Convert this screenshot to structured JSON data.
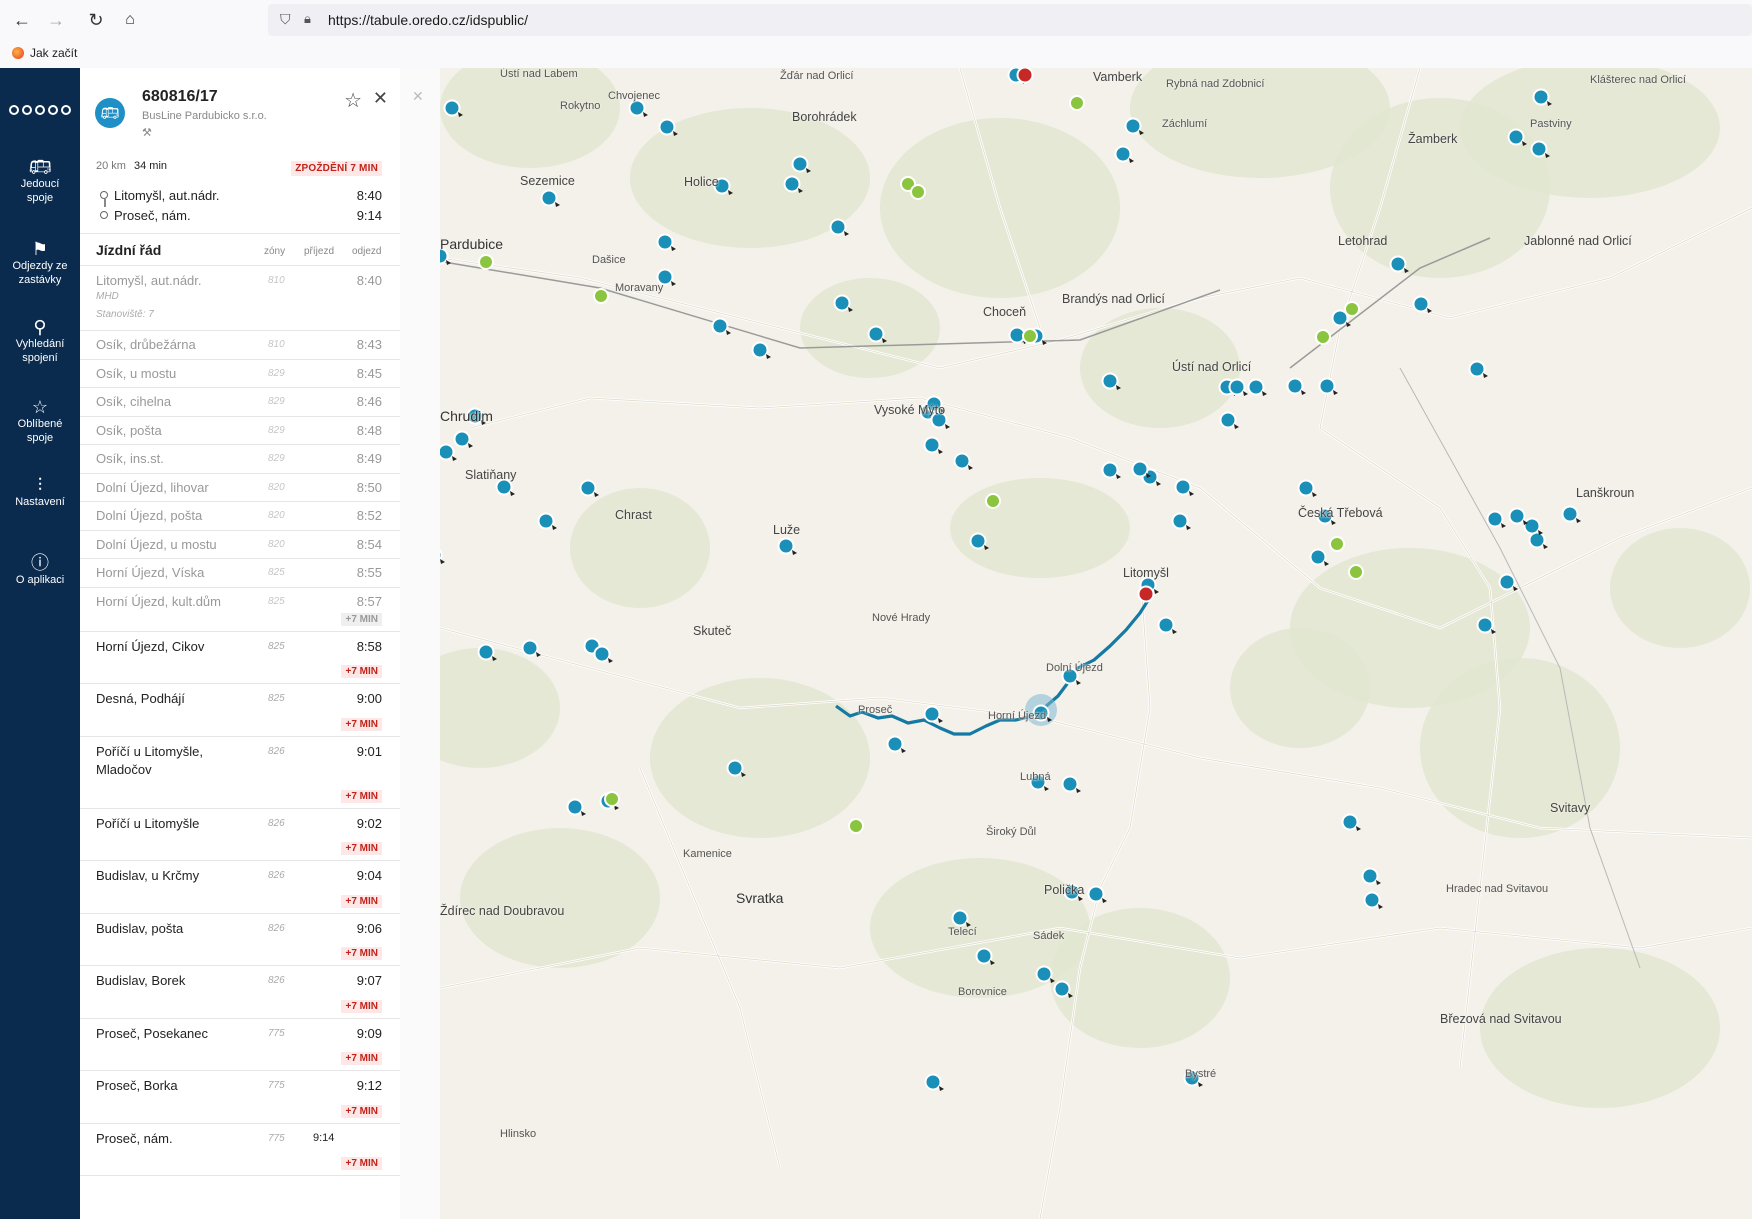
{
  "browser": {
    "url": "https://tabule.oredo.cz/idspublic/",
    "bookmark": "Jak začít"
  },
  "nav": {
    "items": [
      {
        "icon": "bus-icon",
        "label": "Jedoucí spoje"
      },
      {
        "icon": "departures-icon",
        "label": "Odjezdy ze zastávky"
      },
      {
        "icon": "search-icon",
        "label": "Vyhledání spojení"
      },
      {
        "icon": "star-icon",
        "label": "Oblíbené spoje"
      },
      {
        "icon": "sliders-icon",
        "label": "Nastavení"
      },
      {
        "icon": "help-icon",
        "label": "O aplikaci"
      }
    ]
  },
  "trip": {
    "id": "680816/17",
    "carrier": "BusLine Pardubicko s.r.o.",
    "distance": "20 km",
    "duration": "34 min",
    "delay": "ZPOŽDĚNÍ 7 MIN",
    "from": {
      "name": "Litomyšl, aut.nádr.",
      "time": "8:40"
    },
    "to": {
      "name": "Proseč, nám.",
      "time": "9:14"
    }
  },
  "timetable": {
    "title": "Jízdní řád",
    "col_zones": "zóny",
    "col_arrival": "příjezd",
    "col_departure": "odjezd",
    "stops": [
      {
        "name": "Litomyšl, aut.nádr.",
        "zone": "810",
        "dep": "8:40",
        "past": true,
        "note1": "MHD",
        "note2": "Stanoviště: 7"
      },
      {
        "name": "Osík, drůbežárna",
        "zone": "810",
        "dep": "8:43",
        "past": true
      },
      {
        "name": "Osík, u mostu",
        "zone": "829",
        "dep": "8:45",
        "past": true
      },
      {
        "name": "Osík, cihelna",
        "zone": "829",
        "dep": "8:46",
        "past": true
      },
      {
        "name": "Osík, pošta",
        "zone": "829",
        "dep": "8:48",
        "past": true
      },
      {
        "name": "Osík, ins.st.",
        "zone": "829",
        "dep": "8:49",
        "past": true
      },
      {
        "name": "Dolní Újezd, lihovar",
        "zone": "820",
        "dep": "8:50",
        "past": true
      },
      {
        "name": "Dolní Újezd, pošta",
        "zone": "820",
        "dep": "8:52",
        "past": true
      },
      {
        "name": "Dolní Újezd, u mostu",
        "zone": "820",
        "dep": "8:54",
        "past": true
      },
      {
        "name": "Horní Újezd, Víska",
        "zone": "825",
        "dep": "8:55",
        "past": true
      },
      {
        "name": "Horní Újezd, kult.dům",
        "zone": "825",
        "dep": "8:57",
        "past": true,
        "delay": "+7 MIN"
      },
      {
        "name": "Horní Újezd, Cikov",
        "zone": "825",
        "dep": "8:58",
        "delay": "+7 MIN"
      },
      {
        "name": "Desná, Podhájí",
        "zone": "825",
        "dep": "9:00",
        "delay": "+7 MIN"
      },
      {
        "name": "Poříčí u Litomyšle,",
        "name2": "Mladočov",
        "zone": "826",
        "dep": "9:01",
        "delay": "+7 MIN"
      },
      {
        "name": "Poříčí u Litomyšle",
        "zone": "826",
        "dep": "9:02",
        "delay": "+7 MIN"
      },
      {
        "name": "Budislav, u Krčmy",
        "zone": "826",
        "dep": "9:04",
        "delay": "+7 MIN"
      },
      {
        "name": "Budislav, pošta",
        "zone": "826",
        "dep": "9:06",
        "delay": "+7 MIN"
      },
      {
        "name": "Budislav, Borek",
        "zone": "826",
        "dep": "9:07",
        "delay": "+7 MIN"
      },
      {
        "name": "Proseč, Posekanec",
        "zone": "775",
        "dep": "9:09",
        "delay": "+7 MIN"
      },
      {
        "name": "Proseč, Borka",
        "zone": "775",
        "dep": "9:12",
        "delay": "+7 MIN"
      },
      {
        "name": "Proseč, nám.",
        "zone": "775",
        "arr": "9:14",
        "delay": "+7 MIN"
      }
    ]
  },
  "map": {
    "colors": {
      "bus": "#1a8fb8",
      "route": "#1479a3",
      "rail": "#8bc34a",
      "alert": "#c62828"
    },
    "places": [
      "Ústí nad Labem",
      "Žďár nad Orlicí",
      "Vamberk",
      "Rybná nad Zdobnicí",
      "Klášterec nad Orlicí",
      "Borohrádek",
      "Záchlumí",
      "Žamberk",
      "Pastviny",
      "Sezemice",
      "Holice",
      "Chvojenec",
      "Rokytno",
      "Pardubice",
      "Dašice",
      "Moravany",
      "Choceň",
      "Brandýs nad Orlicí",
      "Ústí nad Orlicí",
      "Letohrad",
      "Jablonné nad Orlicí",
      "Chrudim",
      "Slatiňany",
      "Vysoké Mýto",
      "Chrast",
      "Luže",
      "Litomyšl",
      "Česká Třebová",
      "Lanškroun",
      "Skuteč",
      "Proseč",
      "Dolní Újezd",
      "Polička",
      "Svitavy",
      "Sádek",
      "Telecí",
      "Svratka",
      "Ždírec nad Doubravou",
      "Hradec nad Svitavou",
      "Březová nad Svitavou",
      "Bystré",
      "Borovnice",
      "Nové Hrady",
      "Horní Újezd",
      "Lubná",
      "Široký Důl",
      "Kamenice",
      "Hlinsko"
    ]
  }
}
